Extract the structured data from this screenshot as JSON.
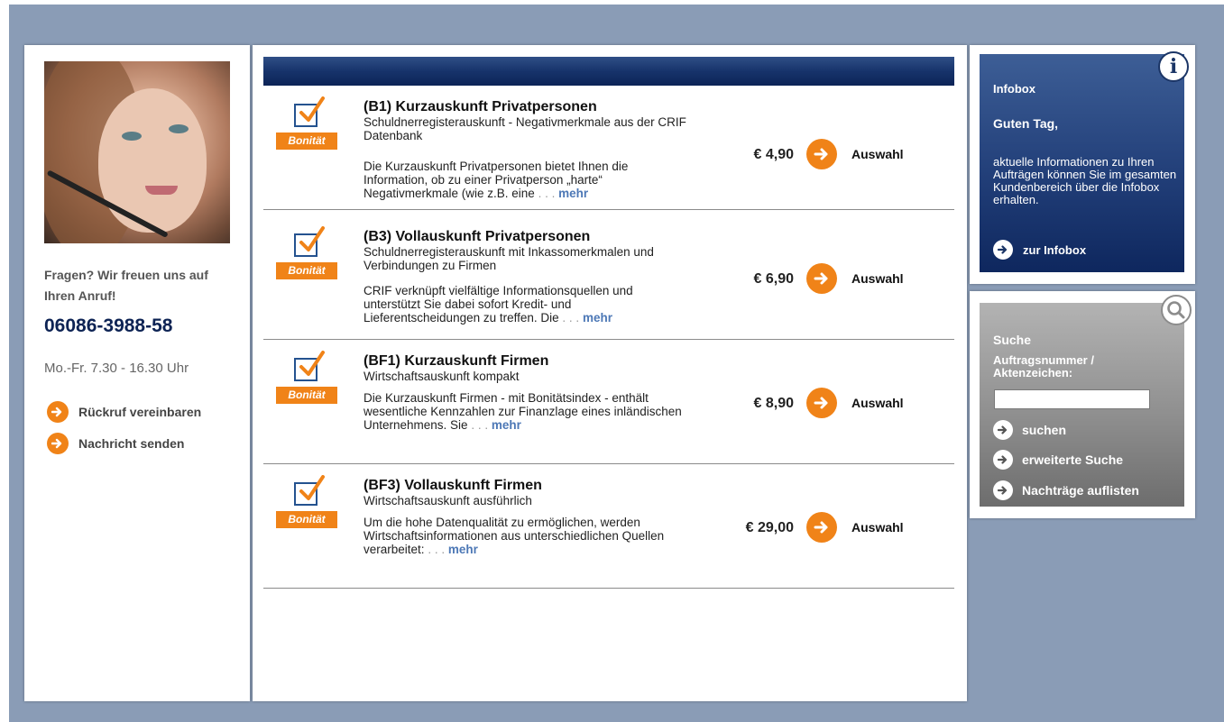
{
  "contact": {
    "question": "Fragen? Wir freuen uns auf Ihren Anruf!",
    "phone": "06086-3988-58",
    "hours": "Mo.-Fr. 7.30 - 16.30 Uhr",
    "callback_label": "Rückruf vereinbaren",
    "message_label": "Nachricht senden"
  },
  "products": [
    {
      "badge": "Bonität",
      "title": "(B1) Kurzauskunft Privatpersonen",
      "subtitle": "Schuldnerregisterauskunft - Negativmerkmale aus der CRIF Datenbank",
      "description": "Die Kurzauskunft Privatpersonen bietet Ihnen die Information, ob zu einer Privatperson „harte“ Negativmerkmale (wie z.B. eine",
      "dots": ". . .",
      "more": "mehr",
      "price": "€ 4,90",
      "select": "Auswahl"
    },
    {
      "badge": "Bonität",
      "title": "(B3) Vollauskunft Privatpersonen",
      "subtitle": "Schuldnerregisterauskunft mit Inkassomerkmalen und Verbindungen zu Firmen",
      "description": "CRIF verknüpft vielfältige Informationsquellen und unterstützt Sie dabei sofort Kredit- und Lieferentscheidungen zu treffen. Die",
      "dots": ". . .",
      "more": "mehr",
      "price": "€ 6,90",
      "select": "Auswahl"
    },
    {
      "badge": "Bonität",
      "title": "(BF1) Kurzauskunft Firmen",
      "subtitle": "Wirtschaftsauskunft kompakt",
      "description": "Die Kurzauskunft Firmen - mit Bonitätsindex - enthält wesentliche Kennzahlen zur Finanzlage eines inländischen Unternehmens. Sie",
      "dots": ". . .",
      "more": "mehr",
      "price": "€ 8,90",
      "select": "Auswahl"
    },
    {
      "badge": "Bonität",
      "title": "(BF3) Vollauskunft Firmen",
      "subtitle": "Wirtschaftsauskunft ausführlich",
      "description": "Um die hohe Datenqualität zu ermöglichen, werden Wirtschaftsinformationen aus unterschiedlichen Quellen verarbeitet:",
      "dots": ". . .",
      "more": "mehr",
      "price": "€ 29,00",
      "select": "Auswahl"
    }
  ],
  "infobox": {
    "title": "Infobox",
    "greeting": "Guten Tag,",
    "text": "aktuelle Informationen zu Ihren Aufträgen können Sie im gesamten Kundenbereich über die Infobox erhalten.",
    "link": "zur Infobox",
    "icon_letter": "i"
  },
  "search": {
    "title": "Suche",
    "label": "Auftragsnummer / Aktenzeichen:",
    "value": "",
    "search_link": "suchen",
    "advanced_link": "erweiterte Suche",
    "list_link": "Nachträge auflisten"
  },
  "colors": {
    "background": "#8a9cb6",
    "accent_orange": "#f08318",
    "navy": "#0d2354",
    "link_blue": "#4d78b6"
  }
}
